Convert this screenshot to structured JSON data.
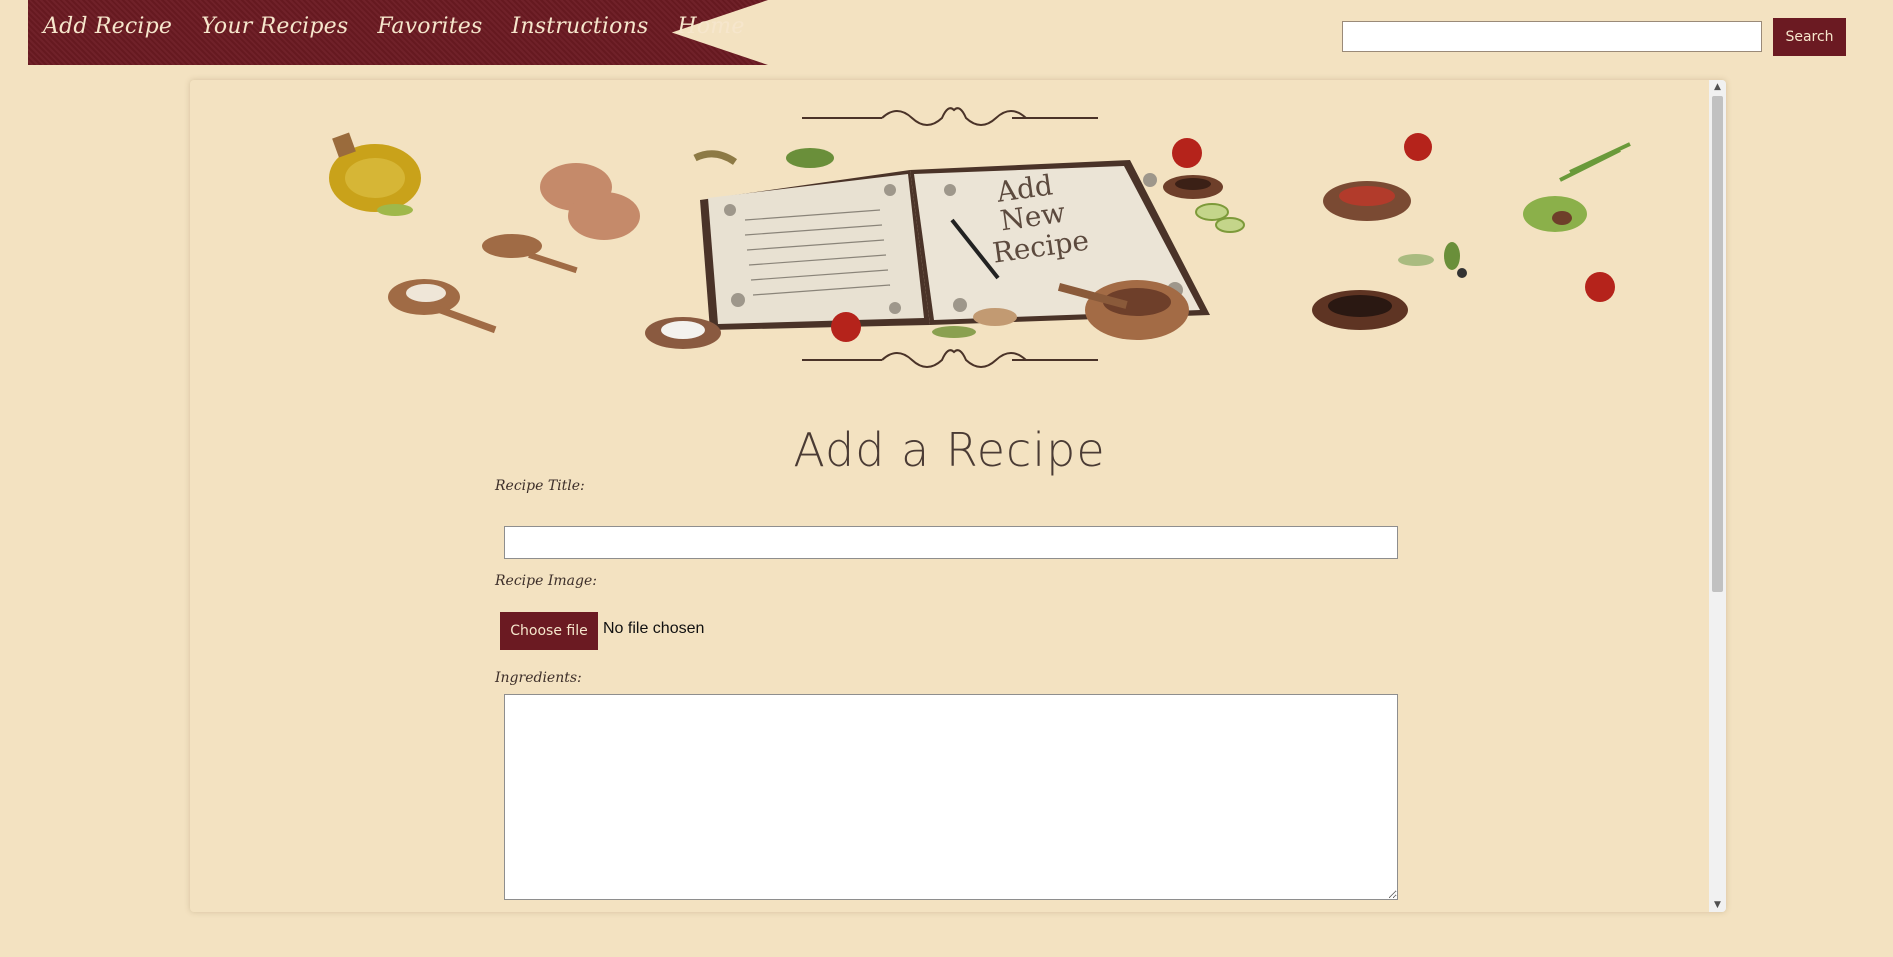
{
  "nav": {
    "items": [
      {
        "label": "Add Recipe"
      },
      {
        "label": "Your Recipes"
      },
      {
        "label": "Favorites"
      },
      {
        "label": "Instructions"
      },
      {
        "label": "Home"
      }
    ]
  },
  "search": {
    "button_label": "Search",
    "value": ""
  },
  "hero": {
    "book_text_line1": "Add",
    "book_text_line2": "New",
    "book_text_line3": "Recipe"
  },
  "form": {
    "page_title": "Add a Recipe",
    "title_label": "Recipe Title:",
    "image_label": "Recipe Image:",
    "choose_file_label": "Choose file",
    "file_status": "No file chosen",
    "ingredients_label": "Ingredients:"
  },
  "colors": {
    "background": "#f3e2c1",
    "accent": "#6b1a22",
    "accent_text": "#f6e6cc"
  }
}
